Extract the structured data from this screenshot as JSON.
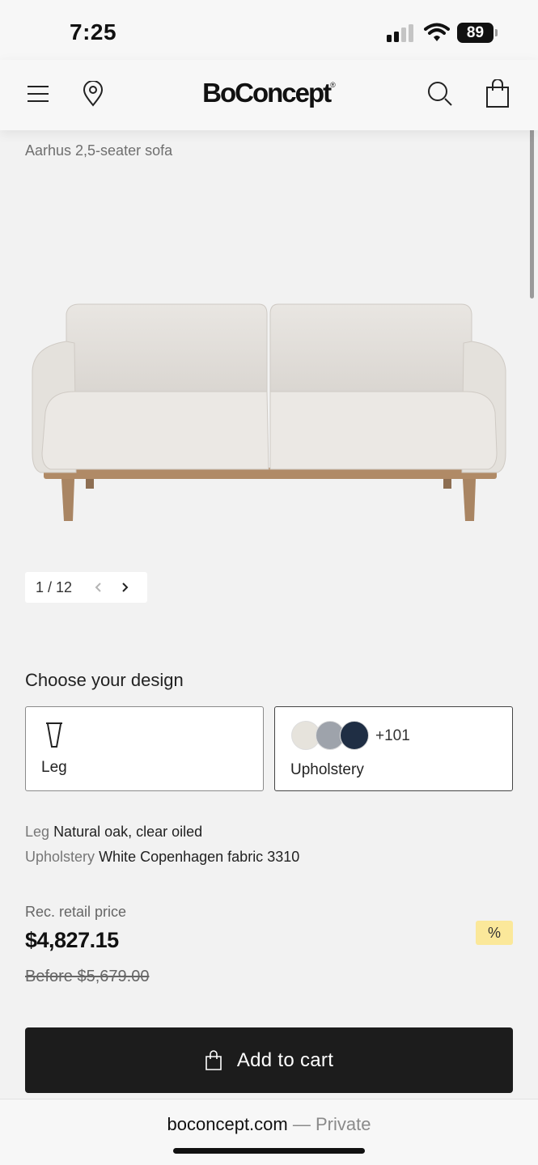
{
  "status_bar": {
    "time": "7:25",
    "battery": "89",
    "icons": [
      "signal-icon",
      "wifi-icon",
      "battery-icon"
    ]
  },
  "header": {
    "brand": "BoConcept",
    "brand_mark": "®",
    "icons": [
      "menu-icon",
      "location-pin-icon",
      "search-icon",
      "shopping-bag-icon"
    ]
  },
  "product": {
    "name": "Aarhus 2,5-seater sofa",
    "image_pager": {
      "count": "1 / 12",
      "prev_icon": "chevron-left-icon",
      "next_icon": "chevron-right-icon"
    }
  },
  "design": {
    "title": "Choose your design",
    "options": [
      {
        "label": "Leg",
        "icon": "table-leg-icon"
      },
      {
        "label": "Upholstery",
        "more_count": "+101",
        "swatches": [
          "#e6e3dc",
          "#9ea3ab",
          "#1f2e44"
        ]
      }
    ]
  },
  "specs": [
    {
      "key": "Leg",
      "value": "Natural oak, clear oiled"
    },
    {
      "key": "Upholstery",
      "value": "White Copenhagen fabric 3310"
    }
  ],
  "price": {
    "label": "Rec. retail price",
    "current": "$4,827.15",
    "before": "Before $5,679.00",
    "badge": "%"
  },
  "cart_button": {
    "label": "Add to cart",
    "icon": "shopping-bag-icon"
  },
  "browser": {
    "domain": "boconcept.com",
    "separator": " — ",
    "mode": "Private"
  },
  "colors": {
    "background": "#f2f2f2",
    "button": "#1c1c1c",
    "badge": "#fbe89a"
  }
}
